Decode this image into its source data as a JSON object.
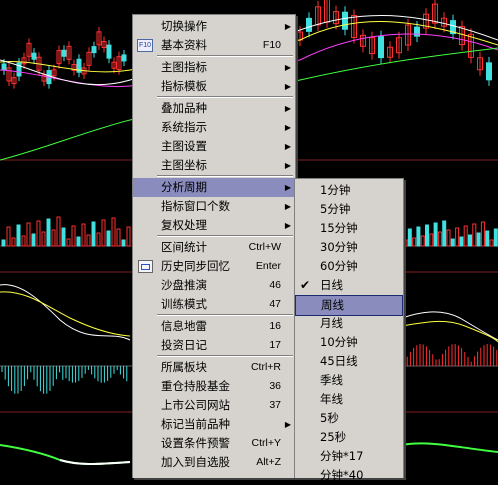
{
  "main_menu": {
    "items": [
      {
        "label": "切换操作",
        "shortcut": "",
        "submenu": true,
        "icon": ""
      },
      {
        "label": "基本资料",
        "shortcut": "F10",
        "submenu": false,
        "icon": "f10-icon"
      },
      {
        "label": "主图指标",
        "shortcut": "",
        "submenu": true,
        "icon": ""
      },
      {
        "label": "指标模板",
        "shortcut": "",
        "submenu": true,
        "icon": ""
      },
      {
        "label": "叠加品种",
        "shortcut": "",
        "submenu": true,
        "icon": ""
      },
      {
        "label": "系统指示",
        "shortcut": "",
        "submenu": true,
        "icon": ""
      },
      {
        "label": "主图设置",
        "shortcut": "",
        "submenu": true,
        "icon": ""
      },
      {
        "label": "主图坐标",
        "shortcut": "",
        "submenu": true,
        "icon": ""
      },
      {
        "label": "分析周期",
        "shortcut": "",
        "submenu": true,
        "icon": "",
        "highlighted": true
      },
      {
        "label": "指标窗口个数",
        "shortcut": "",
        "submenu": true,
        "icon": ""
      },
      {
        "label": "复权处理",
        "shortcut": "",
        "submenu": true,
        "icon": ""
      },
      {
        "label": "区间统计",
        "shortcut": "Ctrl+W",
        "submenu": false,
        "icon": ""
      },
      {
        "label": "历史同步回忆",
        "shortcut": "Enter",
        "submenu": false,
        "icon": "history-sync-icon"
      },
      {
        "label": "沙盘推演",
        "shortcut": "46",
        "submenu": false,
        "icon": ""
      },
      {
        "label": "训练模式",
        "shortcut": "47",
        "submenu": false,
        "icon": ""
      },
      {
        "label": "信息地雷",
        "shortcut": "16",
        "submenu": false,
        "icon": ""
      },
      {
        "label": "投资日记",
        "shortcut": "17",
        "submenu": false,
        "icon": ""
      },
      {
        "label": "所属板块",
        "shortcut": "Ctrl+R",
        "submenu": false,
        "icon": ""
      },
      {
        "label": "重仓持股基金",
        "shortcut": "36",
        "submenu": false,
        "icon": ""
      },
      {
        "label": "上市公司网站",
        "shortcut": "37",
        "submenu": false,
        "icon": ""
      },
      {
        "label": "标记当前品种",
        "shortcut": "",
        "submenu": true,
        "icon": ""
      },
      {
        "label": "设置条件预警",
        "shortcut": "Ctrl+Y",
        "submenu": false,
        "icon": ""
      },
      {
        "label": "加入到自选股",
        "shortcut": "Alt+Z",
        "submenu": false,
        "icon": ""
      }
    ]
  },
  "period_submenu": {
    "items": [
      {
        "label": "1分钟"
      },
      {
        "label": "5分钟"
      },
      {
        "label": "15分钟"
      },
      {
        "label": "30分钟"
      },
      {
        "label": "60分钟"
      },
      {
        "label": "日线",
        "checked": true
      },
      {
        "label": "周线",
        "selected": true
      },
      {
        "label": "月线"
      },
      {
        "label": "10分钟"
      },
      {
        "label": "45日线"
      },
      {
        "label": "季线"
      },
      {
        "label": "年线"
      },
      {
        "label": "5秒"
      },
      {
        "label": "25秒"
      },
      {
        "label": "分钟*17"
      },
      {
        "label": "分钟*40"
      }
    ]
  },
  "colors": {
    "menu_bg": "#d6d3ce",
    "highlight": "#8a8cbe",
    "chart_bg": "#000000",
    "candle_up": "#ff3030",
    "candle_down": "#40e0e0",
    "ma_white": "#ffffff",
    "ma_yellow": "#ffff40",
    "ma_magenta": "#ff40ff",
    "ma_green": "#40ff40"
  }
}
